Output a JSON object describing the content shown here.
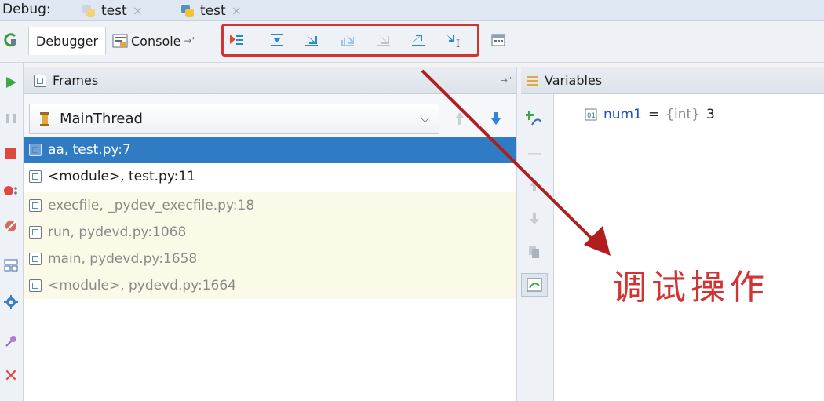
{
  "top": {
    "label": "Debug:",
    "tabs": [
      {
        "label": "test"
      },
      {
        "label": "test"
      }
    ],
    "close_glyph": "×"
  },
  "toolbar": {
    "debugger_tab": "Debugger",
    "console_tab": "Console",
    "console_pin": "→\"",
    "step_buttons": [
      "show-execution-point-icon",
      "step-over-icon",
      "step-into-icon",
      "step-into-my-code-icon",
      "force-step-into-icon",
      "step-out-icon",
      "run-to-cursor-icon",
      "evaluate-expression-icon"
    ]
  },
  "frames": {
    "header": "Frames",
    "pin": "→\"",
    "thread": "MainThread",
    "items": [
      {
        "label": "aa, test.py:7",
        "state": "selected"
      },
      {
        "label": "<module>, test.py:11",
        "state": "normal"
      },
      {
        "label": "execfile, _pydev_execfile.py:18",
        "state": "library"
      },
      {
        "label": "run, pydevd.py:1068",
        "state": "library"
      },
      {
        "label": "main, pydevd.py:1658",
        "state": "library"
      },
      {
        "label": "<module>, pydevd.py:1664",
        "state": "library"
      }
    ]
  },
  "variables": {
    "header": "Variables",
    "items": [
      {
        "name": "num1",
        "eq": "=",
        "type": "{int}",
        "value": "3"
      }
    ]
  },
  "annotation": "调试操作",
  "colors": {
    "selected": "#2f7cc5",
    "library_bg": "#fbfae8",
    "accent_red": "#d23434",
    "icon_blue": "#2b86d6"
  }
}
